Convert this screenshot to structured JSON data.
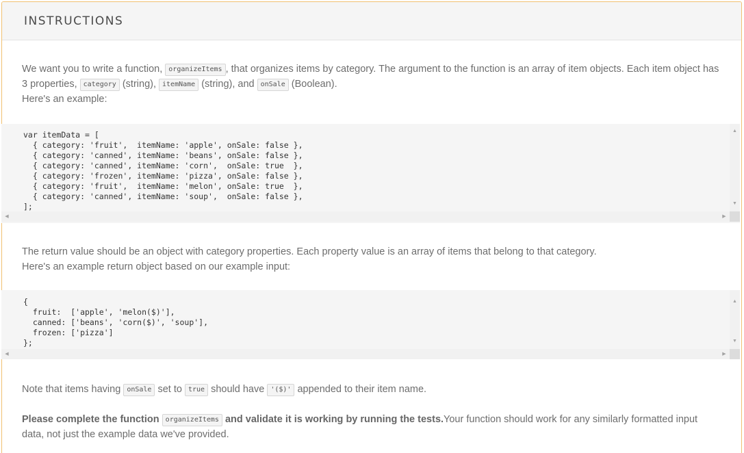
{
  "panel": {
    "title": "INSTRUCTIONS"
  },
  "intro": {
    "t1": "We want you to write a function, ",
    "code1": "organizeItems",
    "t2": ", that organizes items by category. The argument to the function is an array of item objects. Each item object has 3 properties, ",
    "code2": "category",
    "t3": " (string), ",
    "code3": "itemName",
    "t4": " (string), and ",
    "code4": "onSale",
    "t5": " (Boolean).",
    "line2": "Here's an example:"
  },
  "code_example_input": "var itemData = [\n  { category: 'fruit',  itemName: 'apple', onSale: false },\n  { category: 'canned', itemName: 'beans', onSale: false },\n  { category: 'canned', itemName: 'corn',  onSale: true  },\n  { category: 'frozen', itemName: 'pizza', onSale: false },\n  { category: 'fruit',  itemName: 'melon', onSale: true  },\n  { category: 'canned', itemName: 'soup',  onSale: false },\n];",
  "return_desc": {
    "line1": "The return value should be an object with category properties. Each property value is an array of items that belong to that category.",
    "line2": "Here's an example return object based on our example input:"
  },
  "code_example_output": "{\n  fruit:  ['apple', 'melon($)'],\n  canned: ['beans', 'corn($)', 'soup'],\n  frozen: ['pizza']\n};",
  "note": {
    "t1": "Note that items having ",
    "code1": "onSale",
    "t2": " set to ",
    "code2": "true",
    "t3": " should have ",
    "code3": "'($)'",
    "t4": " appended to their item name."
  },
  "final": {
    "b1": "Please complete the function ",
    "code1": "organizeItems",
    "b2": " and validate it is working by running the tests.",
    "t1": "Your function should work for any similarly formatted input data, not just the example data we've provided."
  },
  "icons": {
    "scroll_up": "scroll-up-arrow",
    "scroll_down": "scroll-down-arrow",
    "scroll_left": "scroll-left-arrow",
    "scroll_right": "scroll-right-arrow"
  },
  "colors": {
    "panel_border": "#f0c070",
    "header_bg": "#f5f5f5",
    "code_bg": "#f5f5f5"
  }
}
